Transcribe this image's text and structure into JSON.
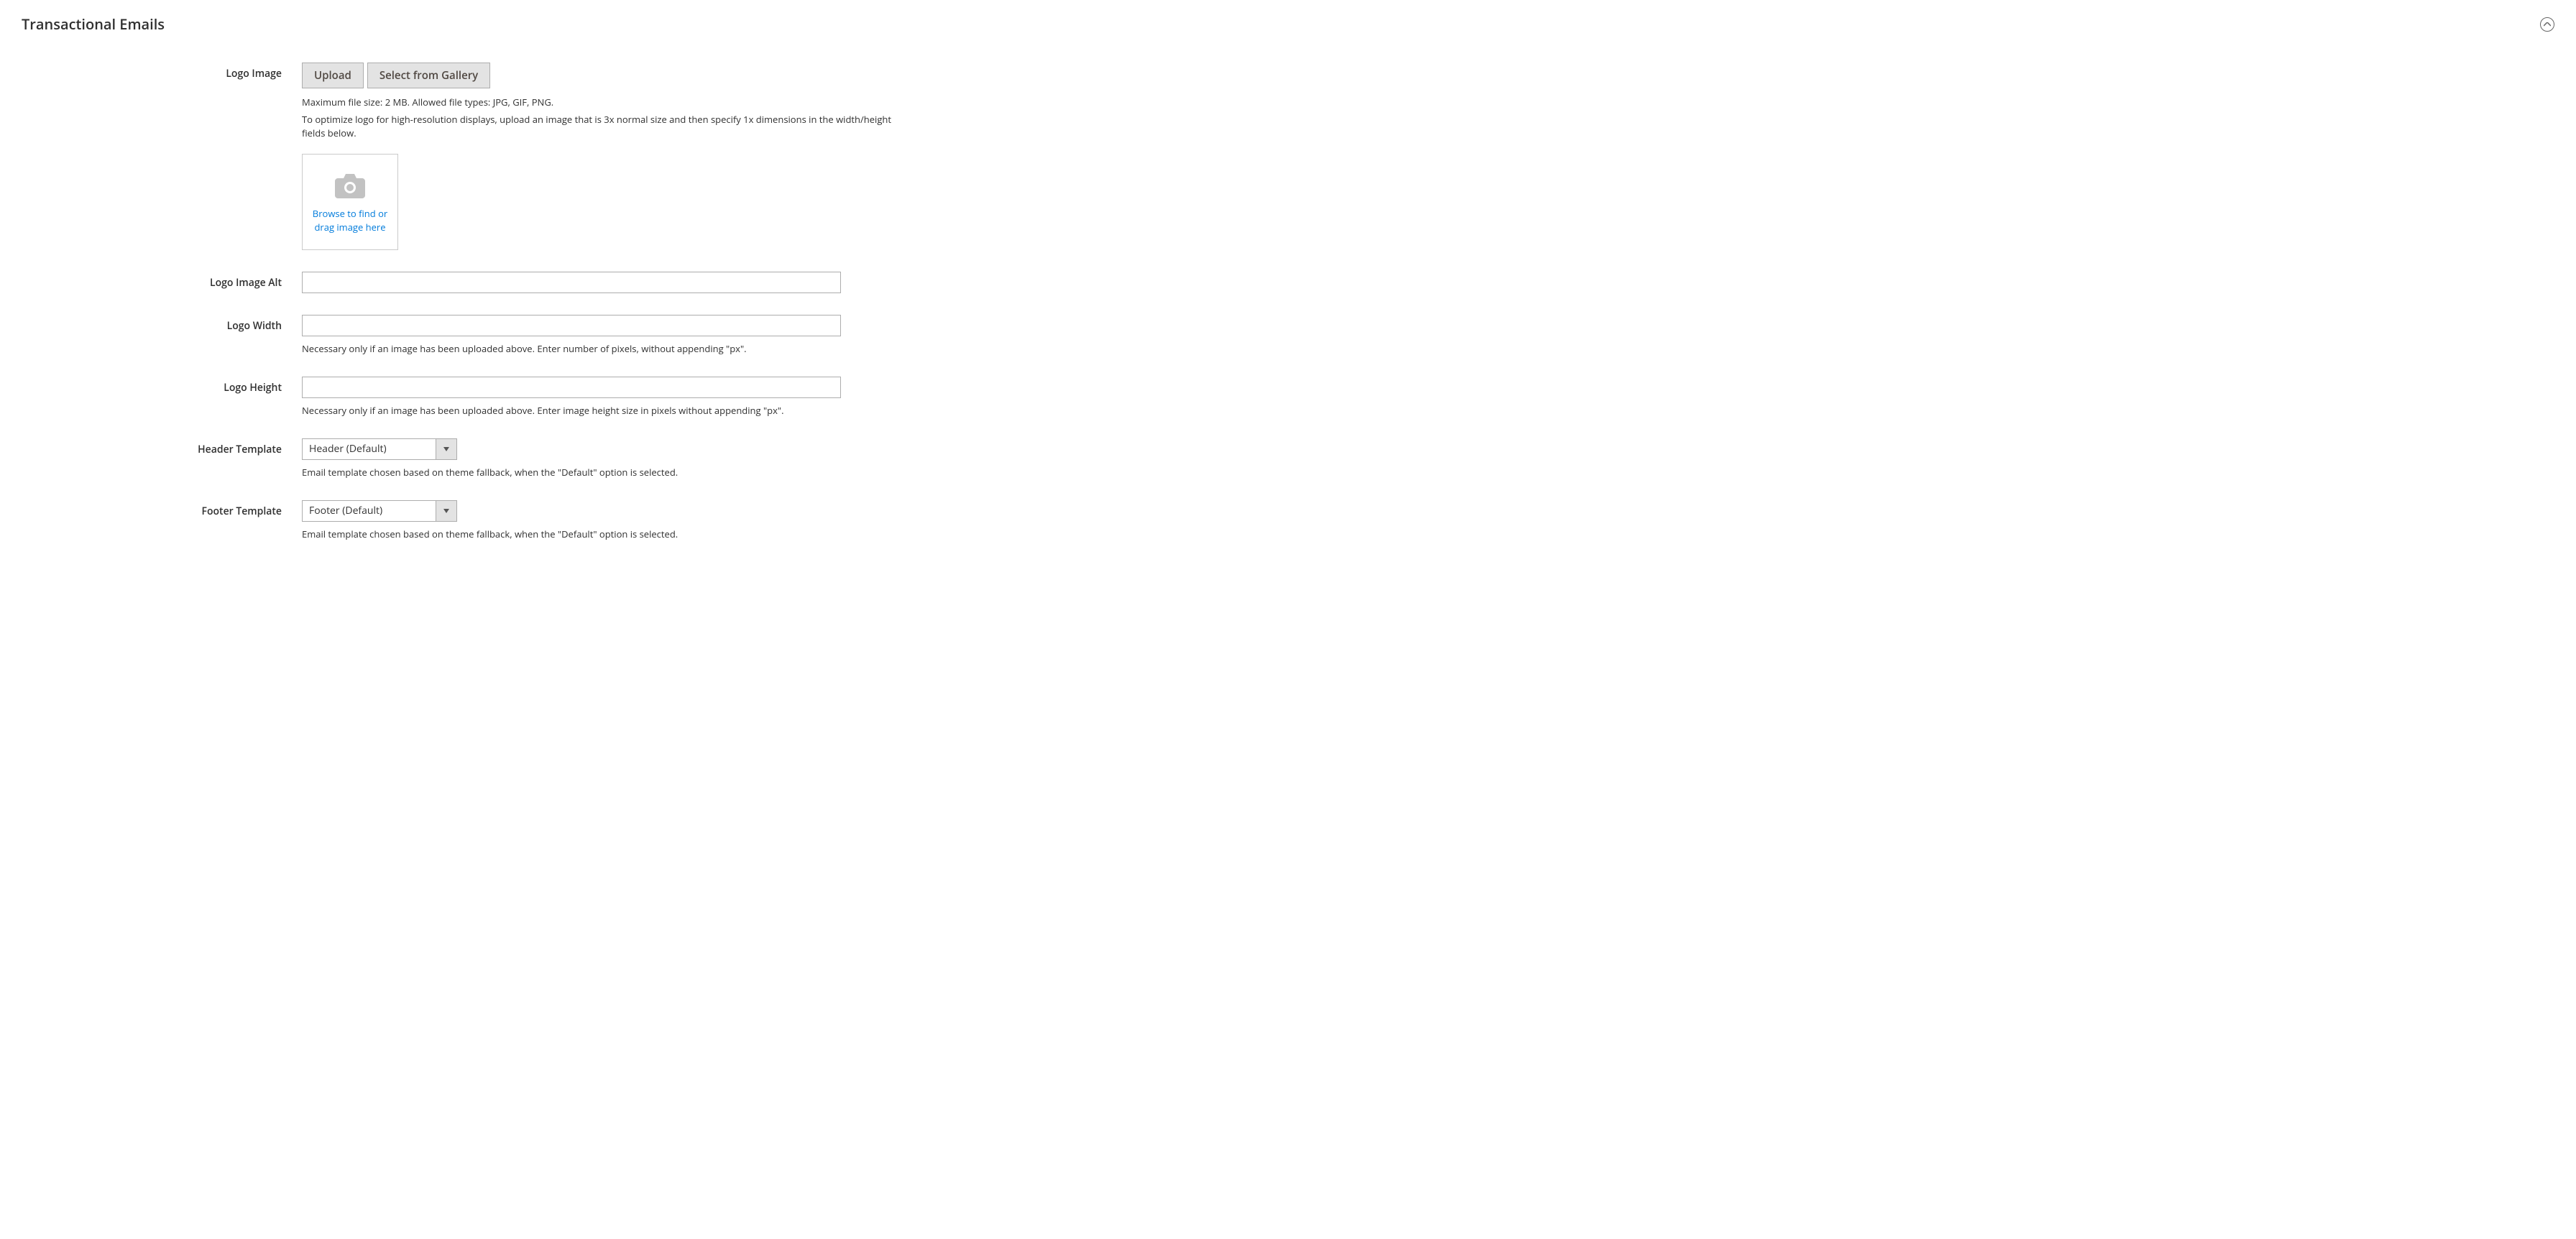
{
  "section": {
    "title": "Transactional Emails"
  },
  "logo_image": {
    "label": "Logo Image",
    "upload_button": "Upload",
    "gallery_button": "Select from Gallery",
    "help1": "Maximum file size: 2 MB. Allowed file types: JPG, GIF, PNG.",
    "help2": "To optimize logo for high-resolution displays, upload an image that is 3x normal size and then specify 1x dimensions in the width/height fields below.",
    "upload_box_text": "Browse to find or drag image here"
  },
  "logo_alt": {
    "label": "Logo Image Alt",
    "value": ""
  },
  "logo_width": {
    "label": "Logo Width",
    "value": "",
    "note": "Necessary only if an image has been uploaded above. Enter number of pixels, without appending \"px\"."
  },
  "logo_height": {
    "label": "Logo Height",
    "value": "",
    "note": "Necessary only if an image has been uploaded above. Enter image height size in pixels without appending \"px\"."
  },
  "header_template": {
    "label": "Header Template",
    "value": "Header (Default)",
    "note": "Email template chosen based on theme fallback, when the \"Default\" option is selected."
  },
  "footer_template": {
    "label": "Footer Template",
    "value": "Footer (Default)",
    "note": "Email template chosen based on theme fallback, when the \"Default\" option is selected."
  }
}
